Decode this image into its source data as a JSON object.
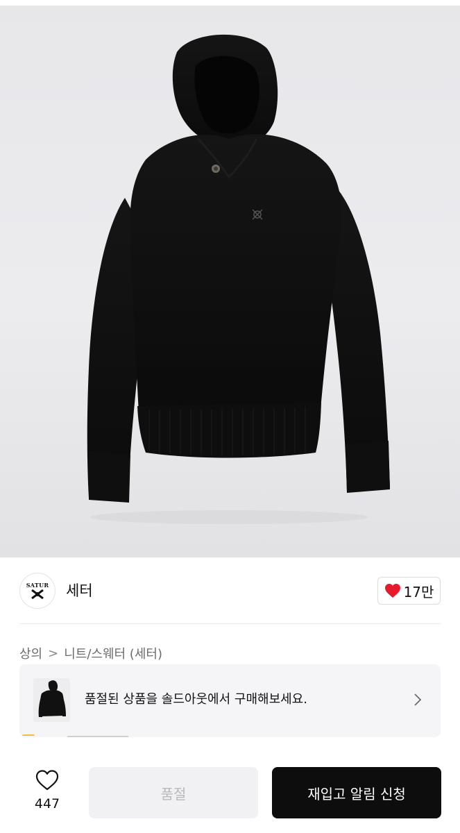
{
  "brand": {
    "logo_text": "SATUR",
    "name": "세터",
    "like_count": "17만"
  },
  "breadcrumb": {
    "level1": "상의",
    "separator": ">",
    "level2": "니트/스웨터 (세터)"
  },
  "soldout_banner": {
    "text": "품절된 상품을 솔드아웃에서 구매해보세요."
  },
  "bottom_bar": {
    "wish_count": "447",
    "soldout_label": "품절",
    "restock_label": "재입고 알림 신청"
  },
  "colors": {
    "accent_heart": "#e8192c",
    "primary_button": "#0d0d0d",
    "disabled_button": "#f1f1f3"
  },
  "icons": [
    "heart-filled-icon",
    "chevron-right-icon",
    "heart-outline-icon"
  ]
}
